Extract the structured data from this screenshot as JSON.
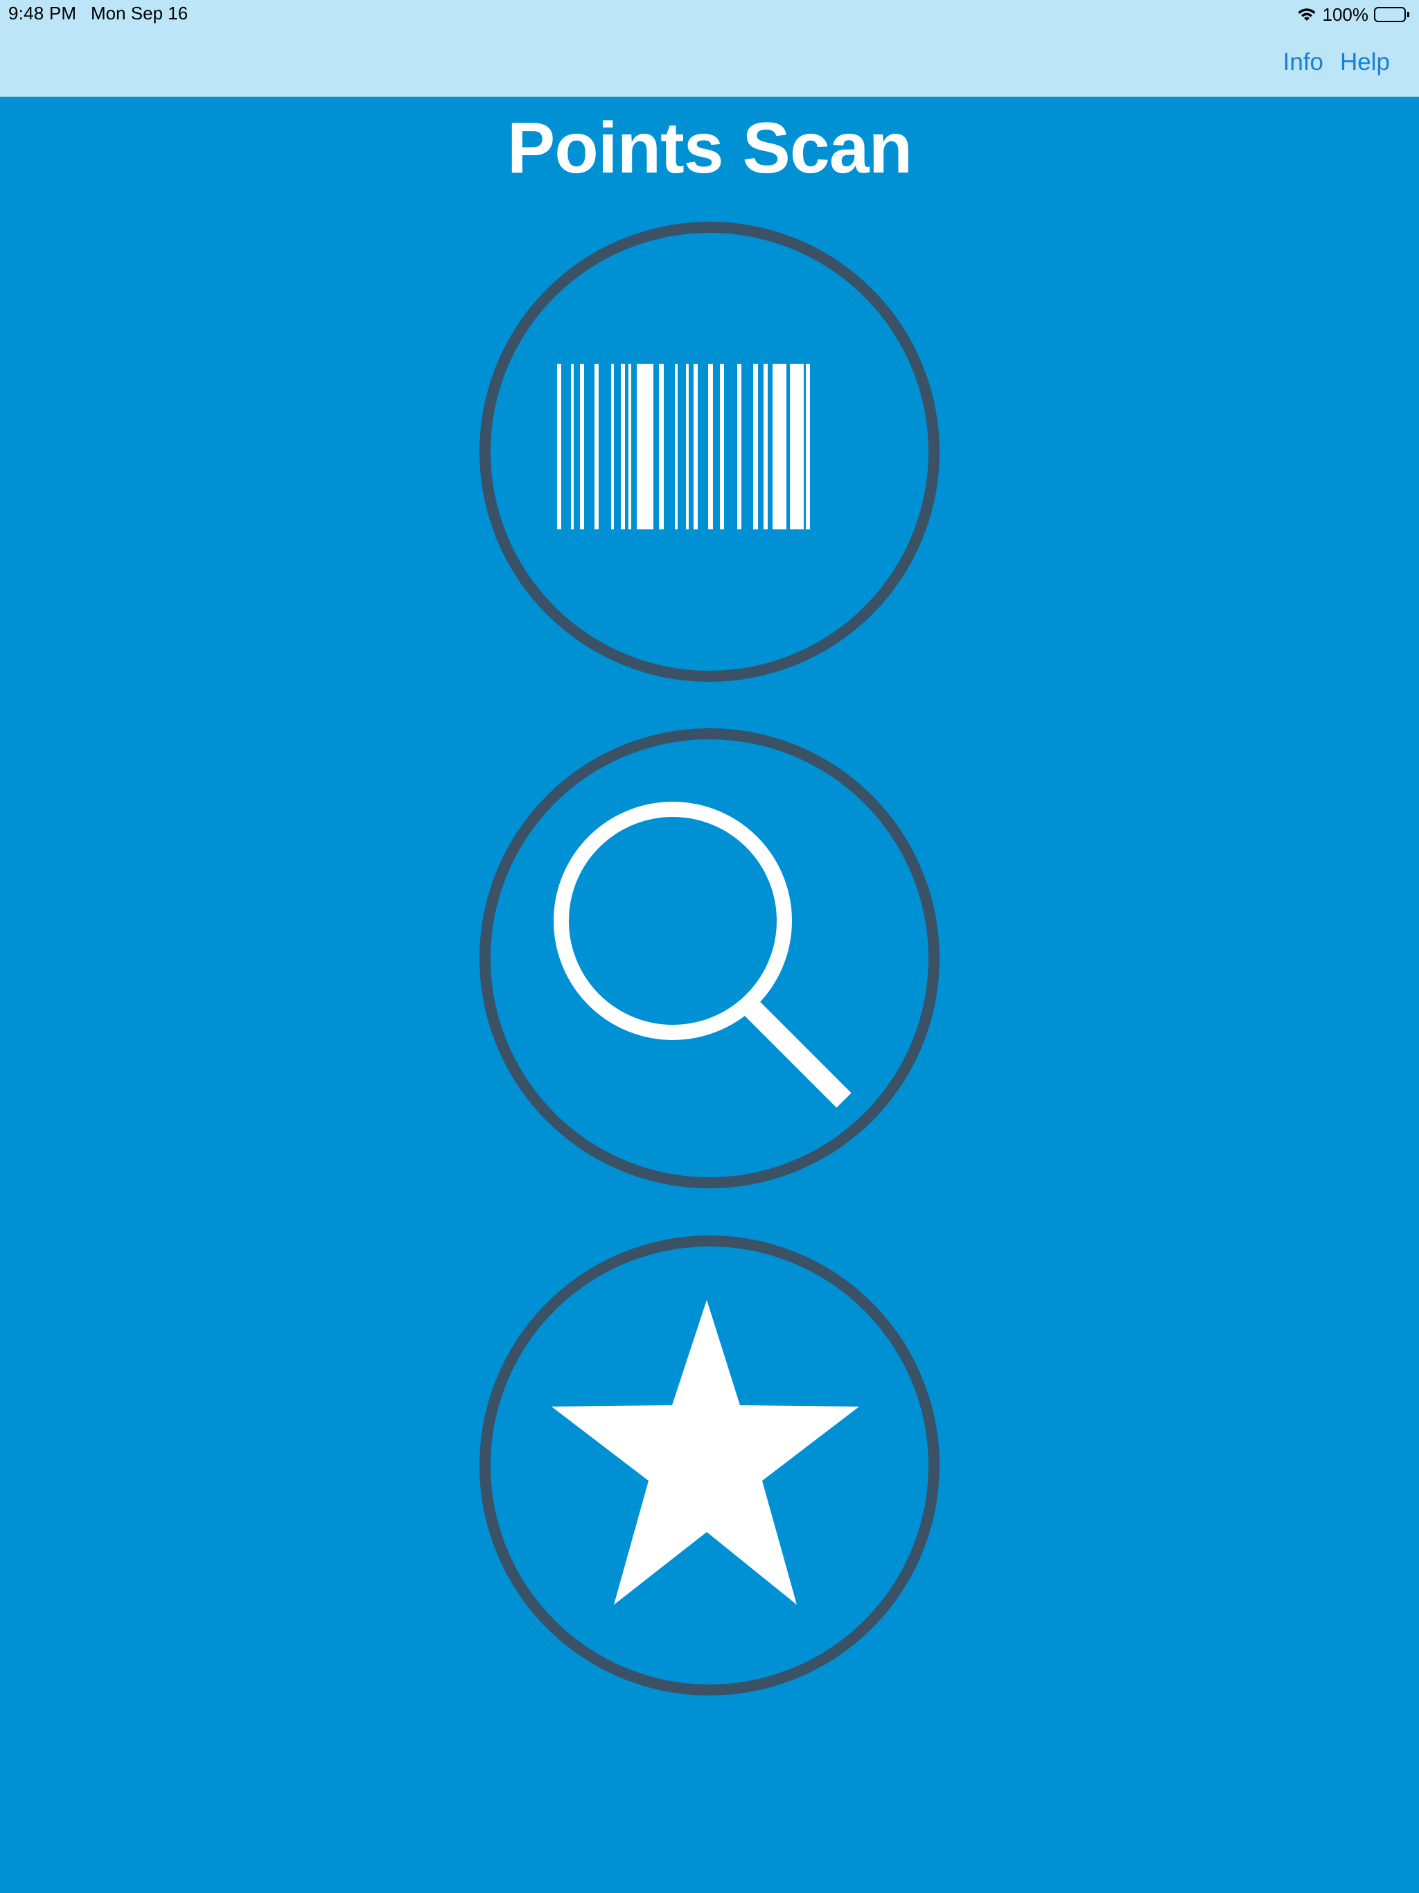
{
  "status_bar": {
    "time": "9:48 PM",
    "date": "Mon Sep 16",
    "battery": "100%",
    "battery_level": 1.0
  },
  "nav": {
    "info_label": "Info",
    "help_label": "Help"
  },
  "app": {
    "title": "Points Scan"
  },
  "buttons": [
    {
      "name": "scan-barcode-button",
      "icon": "barcode-icon"
    },
    {
      "name": "search-button",
      "icon": "magnifying-glass-icon"
    },
    {
      "name": "favorites-button",
      "icon": "star-icon"
    }
  ],
  "colors": {
    "background": "#0091d4",
    "topbar": "#bde5f8",
    "link": "#1a7fd6",
    "circle_border": "#3a5166",
    "icon": "#ffffff"
  }
}
